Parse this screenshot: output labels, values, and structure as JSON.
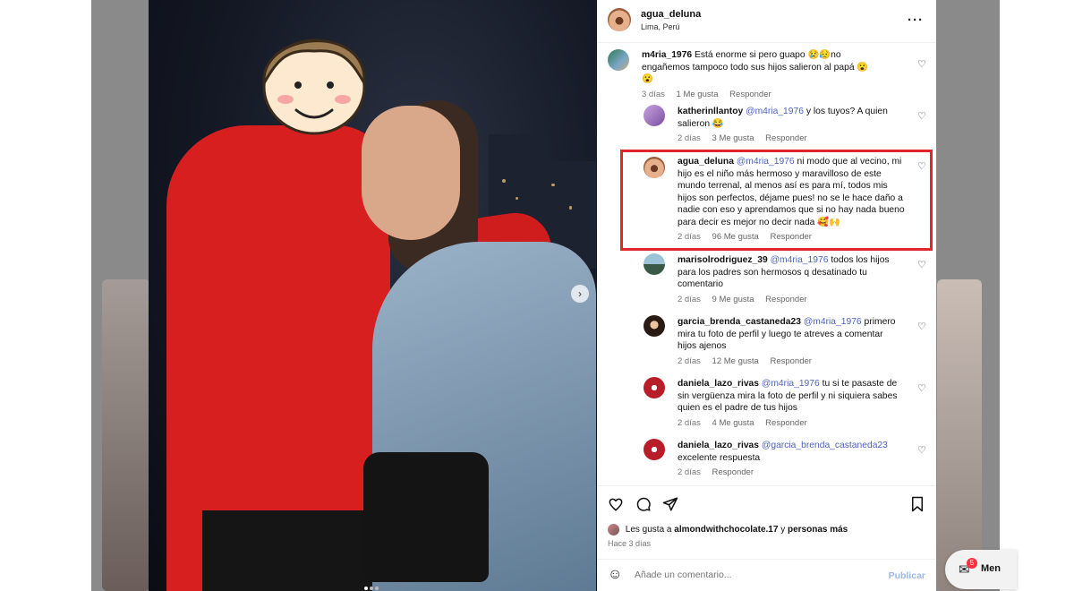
{
  "post": {
    "owner": "agua_deluna",
    "location": "Lima, Perú",
    "more_icon": "more-dots-icon"
  },
  "comments": [
    {
      "user": "m4ria_1976",
      "text": "Está enorme si pero guapo 😢😥no engañemos tampoco todo sus hijos salieron al papá 😮😮",
      "time": "3 días",
      "likes": "1 Me gusta",
      "reply": "Responder"
    },
    {
      "user": "katherinllantoy",
      "mention": "@m4ria_1976",
      "text": "y los tuyos? A quien salieron 😂",
      "time": "2 días",
      "likes": "3 Me gusta",
      "reply": "Responder"
    },
    {
      "user": "agua_deluna",
      "mention": "@m4ria_1976",
      "text": "ni modo que al vecino, mi hijo es el niño más hermoso y maravilloso de este mundo terrenal, al menos así es para mí, todos mis hijos son perfectos, déjame pues! no se le hace daño a nadie con eso y aprendamos que si no hay nada bueno para decir es mejor no decir nada 🥰🙌",
      "time": "2 días",
      "likes": "96 Me gusta",
      "reply": "Responder"
    },
    {
      "user": "marisolrodriguez_39",
      "mention": "@m4ria_1976",
      "text": "todos los hijos para los padres son hermosos q desatinado tu comentario",
      "time": "2 días",
      "likes": "9 Me gusta",
      "reply": "Responder"
    },
    {
      "user": "garcia_brenda_castaneda23",
      "mention": "@m4ria_1976",
      "text": "primero mira tu foto de perfil y luego te atreves a comentar hijos ajenos",
      "time": "2 días",
      "likes": "12 Me gusta",
      "reply": "Responder"
    },
    {
      "user": "daniela_lazo_rivas",
      "mention": "@m4ria_1976",
      "text": "tu si te pasaste de sin vergüenza mira la foto de perfil y ni siquiera sabes quien es el padre de tus hijos",
      "time": "2 días",
      "likes": "4 Me gusta",
      "reply": "Responder"
    },
    {
      "user": "daniela_lazo_rivas",
      "mention": "@garcia_brenda_castaneda23",
      "text": "excelente respuesta",
      "time": "2 días",
      "likes": "",
      "reply": "Responder"
    }
  ],
  "likes_line": {
    "prefix": "Les gusta a",
    "user": "almondwithchocolate.17",
    "connector": "y",
    "rest": "personas más"
  },
  "posted_ago": "Hace 3 días",
  "composer": {
    "placeholder": "Añade un comentario...",
    "publish": "Publicar"
  },
  "messages": {
    "badge": "5",
    "label": "Men"
  }
}
